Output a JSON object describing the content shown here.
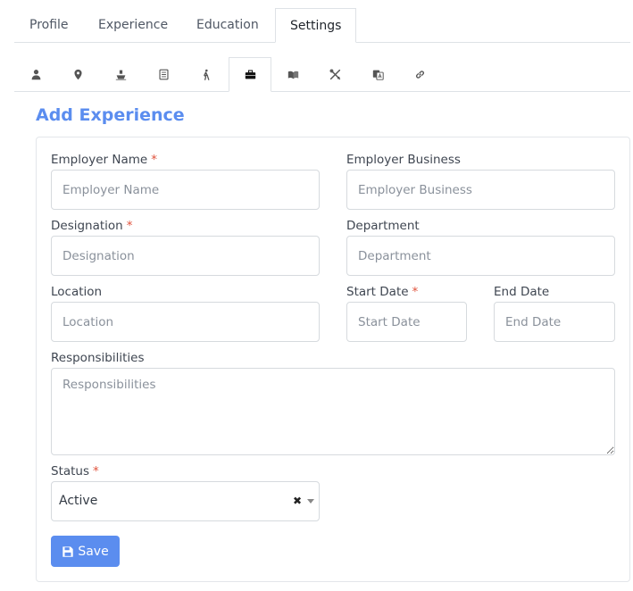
{
  "tabs": {
    "profile": "Profile",
    "experience": "Experience",
    "education": "Education",
    "settings": "Settings"
  },
  "icon_tabs": [
    "user-icon",
    "map-marker-icon",
    "ship-icon",
    "document-icon",
    "walking-icon",
    "briefcase-icon",
    "book-open-icon",
    "tools-icon",
    "language-icon",
    "link-icon"
  ],
  "page_title": "Add Experience",
  "form": {
    "employer_name": {
      "label": "Employer Name",
      "required": "*",
      "placeholder": "Employer Name"
    },
    "employer_business": {
      "label": "Employer Business",
      "placeholder": "Employer Business"
    },
    "designation": {
      "label": "Designation",
      "required": "*",
      "placeholder": "Designation"
    },
    "department": {
      "label": "Department",
      "placeholder": "Department"
    },
    "location": {
      "label": "Location",
      "placeholder": "Location"
    },
    "start_date": {
      "label": "Start Date",
      "required": "*",
      "placeholder": "Start Date"
    },
    "end_date": {
      "label": "End Date",
      "placeholder": "End Date"
    },
    "responsibilities": {
      "label": "Responsibilities",
      "placeholder": "Responsibilities"
    },
    "status": {
      "label": "Status",
      "required": "*",
      "value": "Active",
      "clear": "✖"
    }
  },
  "save_label": "Save",
  "colors": {
    "accent": "#5b8def",
    "required": "#e0533d"
  }
}
